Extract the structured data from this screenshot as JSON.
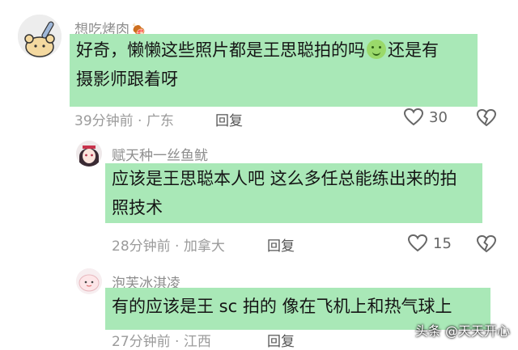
{
  "comments": [
    {
      "username": "想吃烤肉",
      "username_emoji": "🍖",
      "text_before_emoji": "好奇，懒懒这些照片都是王思聪拍的吗",
      "emoji_icon": "grin-emoji-icon",
      "text_after_emoji": "还是有",
      "text_line2": "摄影师跟着呀",
      "time_location": "39分钟前 · 广东",
      "reply_label": "回复",
      "likes": "30"
    },
    {
      "username": "赋天种一丝鱼鱿",
      "text_line1": "应该是王思聪本人吧 这么多任总能练出来的拍",
      "text_line2": "照技术",
      "time_location": "28分钟前 · 加拿大",
      "reply_label": "回复",
      "likes": "15"
    },
    {
      "username": "泡芙冰淇凌",
      "text_line1": "有的应该是王 sc 拍的 像在飞机上和热气球上",
      "time_location": "27分钟前 · 江西",
      "reply_label": "回复"
    }
  ],
  "watermark": "头条 @天天开心",
  "colors": {
    "bubble": "#a9e8b7",
    "meta": "#9b9b9b"
  }
}
